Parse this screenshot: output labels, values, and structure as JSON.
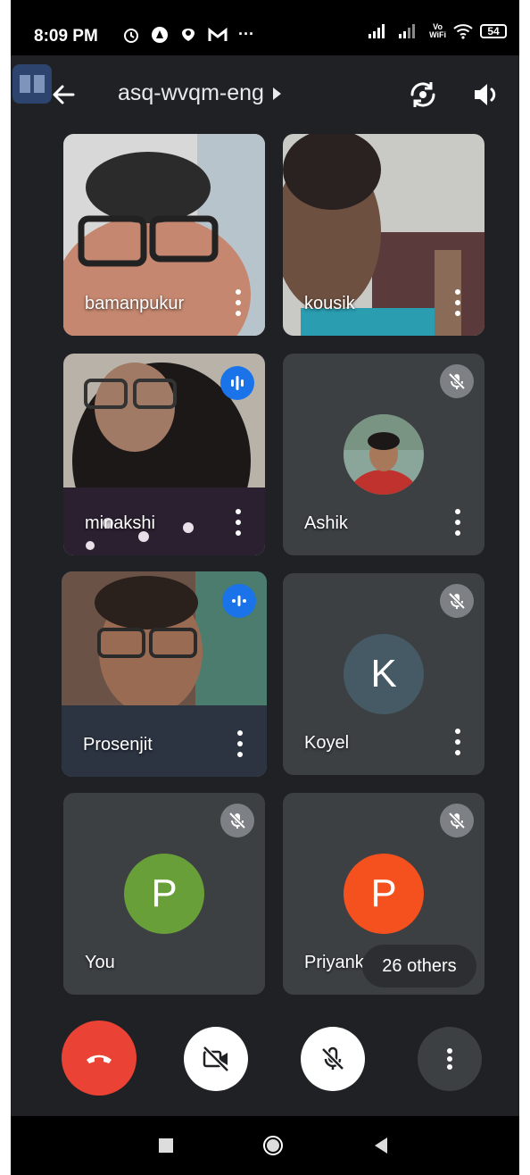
{
  "status": {
    "time": "8:09 PM",
    "battery": "54",
    "vo_wifi": "Vo\nWiFi",
    "left_icons": [
      "alarm-icon",
      "app-icon",
      "drive-icon",
      "gmail-icon",
      "more-notifications-icon"
    ],
    "overflow": "···"
  },
  "header": {
    "meeting_code": "asq-wvqm-eng"
  },
  "participants": [
    {
      "name": "bamanpukur",
      "video": true,
      "muted": false,
      "speaking": false
    },
    {
      "name": "kousik",
      "video": true,
      "muted": false,
      "speaking": false
    },
    {
      "name": "minakshi",
      "video": true,
      "muted": false,
      "speaking": true
    },
    {
      "name": "Ashik",
      "video": false,
      "muted": true,
      "avatar": "photo"
    },
    {
      "name": "Prosenjit",
      "video": true,
      "muted": false,
      "speaking": true,
      "active": true
    },
    {
      "name": "Koyel",
      "video": false,
      "muted": true,
      "avatar_letter": "K",
      "avatar_color": "#455a64"
    },
    {
      "name": "You",
      "video": false,
      "muted": true,
      "avatar_letter": "P",
      "avatar_color": "#689f38"
    },
    {
      "name": "Priyanka",
      "video": false,
      "muted": true,
      "avatar_letter": "P",
      "avatar_color": "#f4511e"
    }
  ],
  "others_label": "26 others",
  "controls": {
    "end_call_color": "#ea4335"
  },
  "colors": {
    "background": "#202124",
    "accent": "#1a73e8"
  }
}
